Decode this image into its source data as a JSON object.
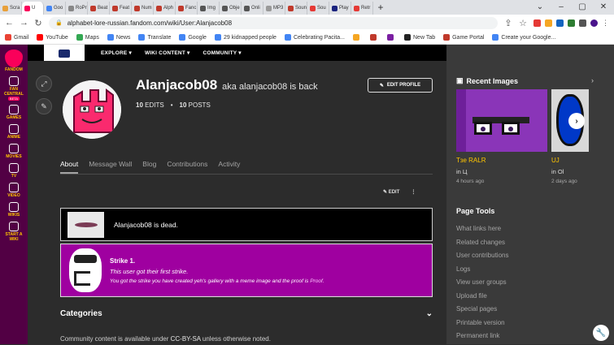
{
  "browser": {
    "tabs": [
      {
        "label": "Scra",
        "color": "#e8a03a"
      },
      {
        "label": "U",
        "color": "#fa005a",
        "active": true
      },
      {
        "label": "Goo",
        "color": "#4285f4"
      },
      {
        "label": "RoPr",
        "color": "#888888"
      },
      {
        "label": "Beat",
        "color": "#c0392b"
      },
      {
        "label": "Feat",
        "color": "#c0392b"
      },
      {
        "label": "Num",
        "color": "#c0392b"
      },
      {
        "label": "Alph",
        "color": "#c0392b"
      },
      {
        "label": "Fanc",
        "color": "#c0392b"
      },
      {
        "label": "Img",
        "color": "#555555"
      },
      {
        "label": "Obje",
        "color": "#555555"
      },
      {
        "label": "Onli",
        "color": "#555555"
      },
      {
        "label": "MP3",
        "color": "#999999"
      },
      {
        "label": "Soun",
        "color": "#c0392b"
      },
      {
        "label": "Sou",
        "color": "#e53935"
      },
      {
        "label": "Play",
        "color": "#1a237e"
      },
      {
        "label": "Retr",
        "color": "#e53935"
      }
    ],
    "new_tab": "+",
    "url": "alphabet-lore-russian.fandom.com/wiki/User:Alanjacob08",
    "bookmarks": [
      {
        "label": "Gmail",
        "color": "#ea4335"
      },
      {
        "label": "YouTube",
        "color": "#ff0000"
      },
      {
        "label": "Maps",
        "color": "#34a853"
      },
      {
        "label": "News",
        "color": "#4285f4"
      },
      {
        "label": "Translate",
        "color": "#4285f4"
      },
      {
        "label": "Google",
        "color": "#4285f4"
      },
      {
        "label": "29 kidnapped people",
        "color": "#4285f4"
      },
      {
        "label": "Celebrating Pacita...",
        "color": "#4285f4"
      },
      {
        "label": "",
        "color": "#f5a623"
      },
      {
        "label": "",
        "color": "#c0392b"
      },
      {
        "label": "",
        "color": "#7b1fa2"
      },
      {
        "label": "New Tab",
        "color": "#222222"
      },
      {
        "label": "Game Portal",
        "color": "#c0392b"
      },
      {
        "label": "Create your Google...",
        "color": "#4285f4"
      }
    ]
  },
  "rail": {
    "brand": "FANDOM",
    "items": [
      {
        "label": "FAN\nCENTRAL",
        "badge": "BETA"
      },
      {
        "label": "GAMES"
      },
      {
        "label": "ANIME"
      },
      {
        "label": "MOVIES"
      },
      {
        "label": "TV"
      },
      {
        "label": "VIDEO"
      },
      {
        "label": "WIKIS"
      },
      {
        "label": "START A\nWIKI"
      }
    ]
  },
  "topnav": {
    "explore": "EXPLORE ▾",
    "wiki_content": "WIKI CONTENT ▾",
    "community": "COMMUNITY ▾"
  },
  "profile": {
    "username": "Alanjacob08",
    "aka": "aka alanjacob08 is back",
    "edits_count": "10",
    "edits_label": "EDITS",
    "posts_count": "10",
    "posts_label": "POSTS",
    "edit_profile": "EDIT PROFILE",
    "tabs": [
      "About",
      "Message Wall",
      "Blog",
      "Contributions",
      "Activity"
    ],
    "edit_label": "EDIT"
  },
  "content": {
    "dead_text": "Alanjacob08 is dead.",
    "strike_title": "Strike 1.",
    "strike_sub": "This user got their first strike.",
    "strike_detail": "You got the strike you have created yeh's gallery with a meme image and the proof is ",
    "strike_link": "Proof.",
    "categories": "Categories",
    "footer_prefix": "Community content is available under ",
    "footer_license": "CC-BY-SA",
    "footer_suffix": " unless otherwise noted."
  },
  "sidebar": {
    "recent_images_title": "Recent Images",
    "images": [
      {
        "name": "Тзе RALR",
        "in": "in Ц",
        "time": "4 hours ago"
      },
      {
        "name": "UJ",
        "in": "in Ol",
        "time": "2 days ago"
      }
    ],
    "page_tools_title": "Page Tools",
    "page_tools": [
      "What links here",
      "Related changes",
      "User contributions",
      "Logs",
      "View user groups",
      "Upload file",
      "Special pages",
      "Printable version",
      "Permanent link"
    ]
  }
}
